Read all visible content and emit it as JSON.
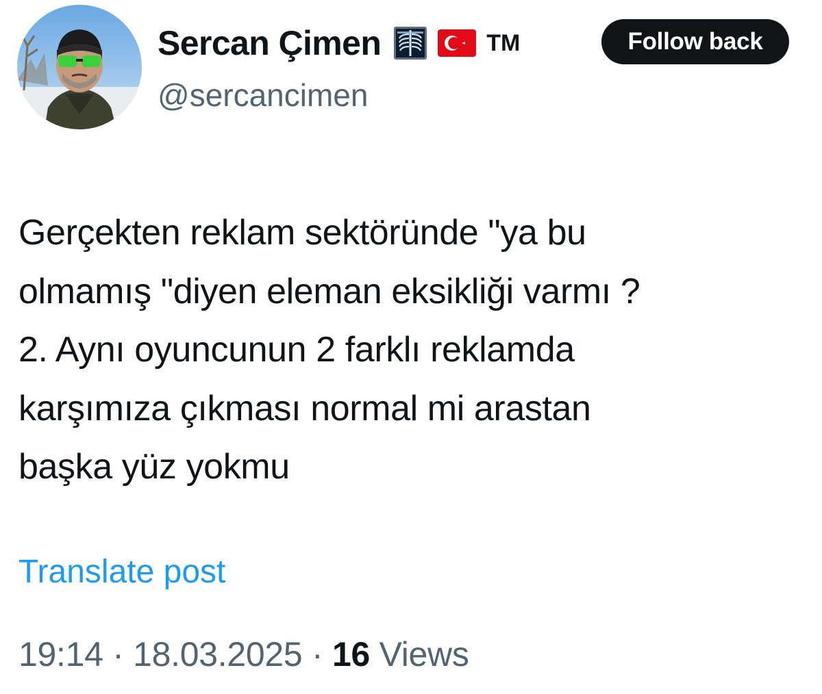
{
  "author": {
    "display_name": "Sercan Çimen",
    "handle": "@sercancimen",
    "badges": {
      "xray_emoji": "x-ray-emoji-icon",
      "flag_emoji": "turkey-flag-icon",
      "tm_label": "TM"
    },
    "avatar": "profile-photo"
  },
  "actions": {
    "follow_label": "Follow back"
  },
  "post": {
    "lines": [
      "Gerçekten reklam sektöründe \"ya bu",
      "olmamış \"diyen eleman eksikliği varmı ?",
      "2. Aynı oyuncunun 2 farklı reklamda",
      "karşımıza çıkması normal mi arastan",
      "başka yüz yokmu"
    ],
    "translate_label": "Translate post"
  },
  "meta": {
    "time": "19:14",
    "separator": "·",
    "date": "18.03.2025",
    "views_count": "16",
    "views_label": "Views"
  },
  "colors": {
    "text_primary": "#0f1419",
    "text_secondary": "#536471",
    "link": "#1d9bf0",
    "button_bg": "#0f1419",
    "flag_red": "#e30a17"
  }
}
